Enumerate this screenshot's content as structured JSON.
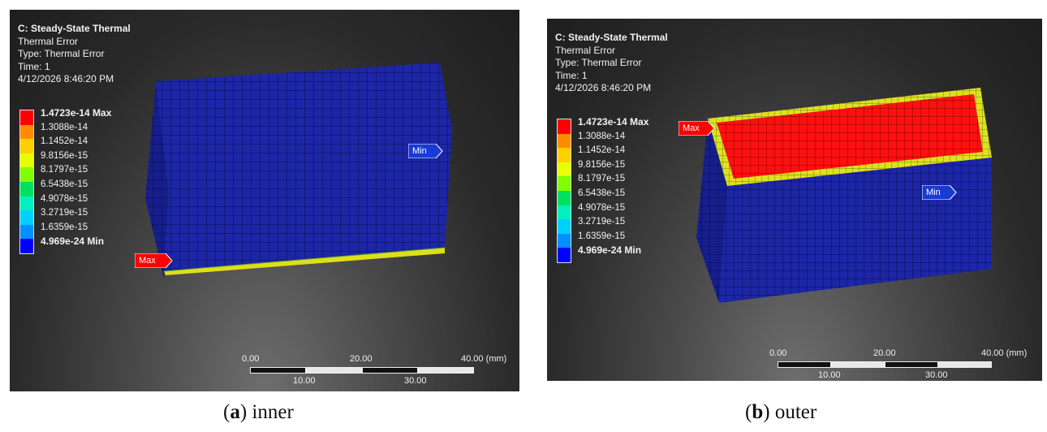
{
  "panels": [
    {
      "header": {
        "title": "C: Steady-State Thermal",
        "result": "Thermal Error",
        "type": "Type: Thermal Error",
        "time": "Time: 1",
        "timestamp": "4/12/2026 8:46:20 PM"
      },
      "probe_max": "Max",
      "probe_min": "Min",
      "caption": {
        "letter": "a",
        "text": "inner"
      }
    },
    {
      "header": {
        "title": "C: Steady-State Thermal",
        "result": "Thermal Error",
        "type": "Type: Thermal Error",
        "time": "Time: 1",
        "timestamp": "4/12/2026 8:46:20 PM"
      },
      "probe_max": "Max",
      "probe_min": "Min",
      "caption": {
        "letter": "b",
        "text": "outer"
      }
    }
  ],
  "legend": {
    "labels": [
      "1.4723e-14 Max",
      "1.3088e-14",
      "1.1452e-14",
      "9.8156e-15",
      "8.1797e-15",
      "6.5438e-15",
      "4.9078e-15",
      "3.2719e-15",
      "1.6359e-15",
      "4.969e-24 Min"
    ],
    "colors": [
      "#ff0000",
      "#ff8c00",
      "#ffd000",
      "#e8ff00",
      "#7fff00",
      "#00e060",
      "#00f0c0",
      "#00d0ff",
      "#0090ff",
      "#0000ff"
    ]
  },
  "scale_bar": {
    "top_ticks": [
      "0.00",
      "20.00",
      "40.00 (mm)"
    ],
    "bottom_ticks": [
      "10.00",
      "30.00"
    ]
  },
  "colors": {
    "mesh_blue": "#1c26a6",
    "max_red": "#ff0000",
    "edge_yellow": "#dede1a",
    "min_tag_blue": "#1a3ad6"
  }
}
